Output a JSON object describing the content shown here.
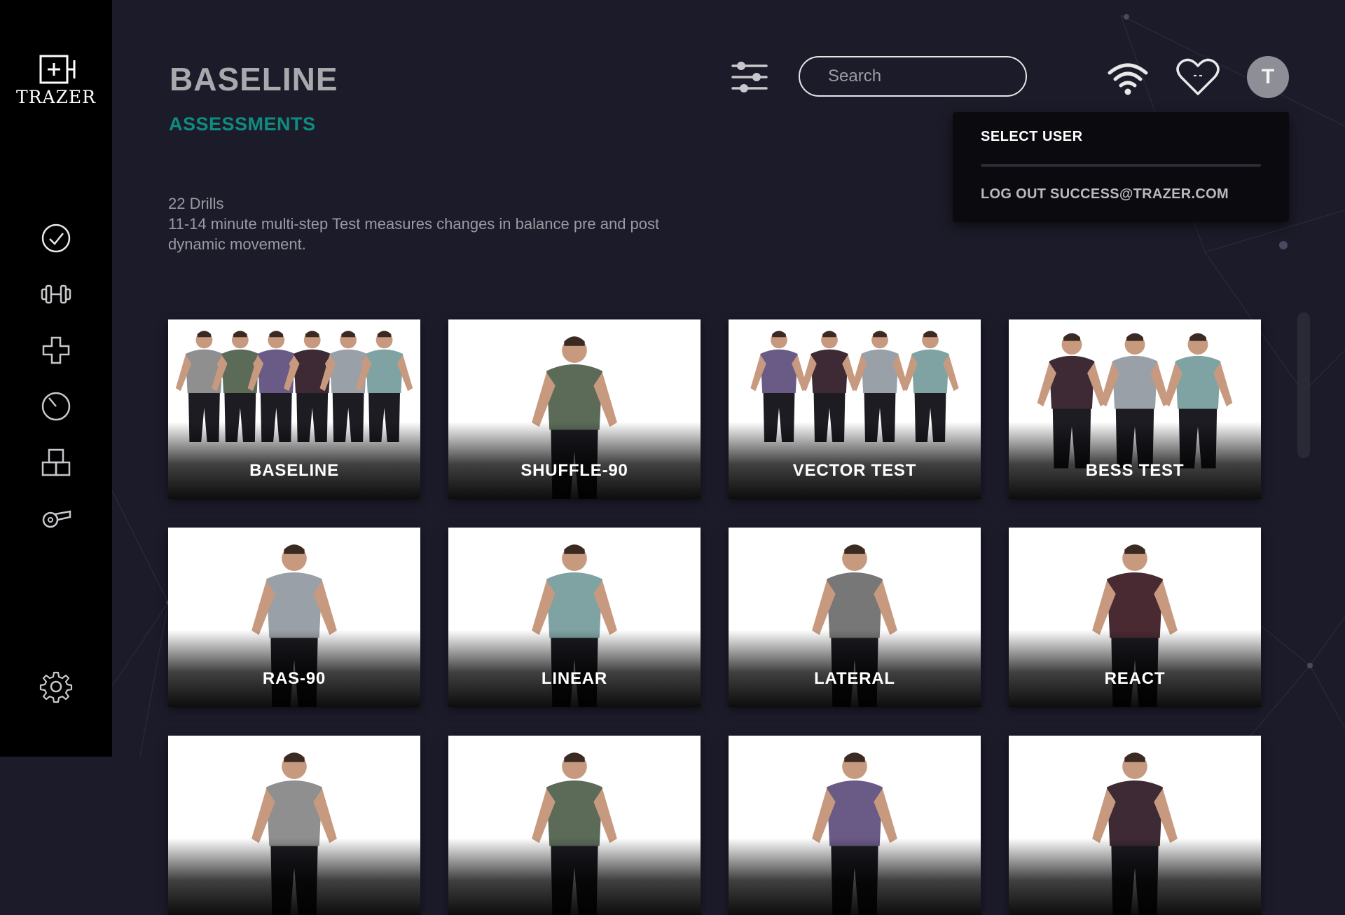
{
  "brand": {
    "name": "TRAZER"
  },
  "sidebar": {
    "items": [
      {
        "name": "assessments",
        "icon": "check-circle-icon"
      },
      {
        "name": "training",
        "icon": "dumbbell-icon"
      },
      {
        "name": "rehab",
        "icon": "medical-cross-icon"
      },
      {
        "name": "timer",
        "icon": "timer-icon"
      },
      {
        "name": "programs",
        "icon": "blocks-icon"
      },
      {
        "name": "coach",
        "icon": "whistle-icon"
      }
    ],
    "settings_icon": "gear-icon"
  },
  "header": {
    "title": "BASELINE",
    "subtitle": "ASSESSMENTS",
    "drill_count": "22 Drills",
    "description": "11-14 minute multi-step Test measures changes in balance pre and post dynamic movement.",
    "search_placeholder": "Search",
    "avatar_initial": "T"
  },
  "user_menu": {
    "select_user": "SELECT USER",
    "logout": "LOG OUT SUCCESS@TRAZER.COM"
  },
  "cards": [
    {
      "label": "BASELINE",
      "people": 6
    },
    {
      "label": "SHUFFLE-90",
      "people": 1
    },
    {
      "label": "VECTOR TEST",
      "people": 4
    },
    {
      "label": "BESS TEST",
      "people": 3
    },
    {
      "label": "RAS-90",
      "people": 1
    },
    {
      "label": "LINEAR",
      "people": 1
    },
    {
      "label": "LATERAL",
      "people": 1
    },
    {
      "label": "REACT",
      "people": 1
    },
    {
      "label": "",
      "people": 1
    },
    {
      "label": "",
      "people": 1
    },
    {
      "label": "",
      "people": 1
    },
    {
      "label": "",
      "people": 1
    }
  ],
  "colors": {
    "background": "#1c1b29",
    "sidebar": "#000000",
    "accent": "#0f8c80",
    "title": "#a8a8ad"
  }
}
